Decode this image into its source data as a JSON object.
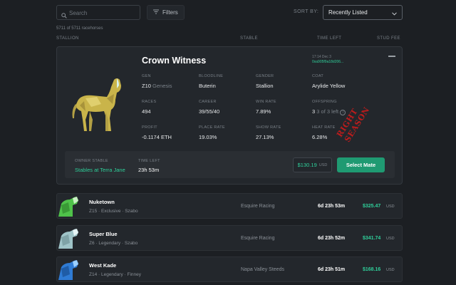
{
  "search": {
    "placeholder": "Search",
    "icon": "search-icon"
  },
  "filters": {
    "label": "Filters",
    "icon": "filter-icon"
  },
  "sort": {
    "label": "SORT BY:",
    "selected": "Recently Listed",
    "icon": "chevron-down-icon"
  },
  "count": "5711 of 5711 racehorses",
  "columns": {
    "stallion": "STALLION",
    "stable": "STABLE",
    "time_left": "TIME LEFT",
    "stud_fee": "STUD FEE"
  },
  "expanded": {
    "name": "Crown Witness",
    "tx_meta": "17:14 Dec 3",
    "tx_hash": "0xa905f9a18d206...",
    "stats": [
      {
        "label": "GEN",
        "value": "Z10",
        "sub": "Genesis"
      },
      {
        "label": "BLOODLINE",
        "value": "Buterin"
      },
      {
        "label": "GENDER",
        "value": "Stallion"
      },
      {
        "label": "COAT",
        "value": "Arylide Yellow"
      },
      {
        "label": "RACES",
        "value": "494"
      },
      {
        "label": "CAREER",
        "value": "39/55/40"
      },
      {
        "label": "WIN RATE",
        "value": "7.89%"
      },
      {
        "label": "OFFSPRING",
        "value": "3",
        "sub": "3 of 3 left"
      },
      {
        "label": "PROFIT",
        "value": "-0.1174 ETH"
      },
      {
        "label": "PLACE RATE",
        "value": "19.03%"
      },
      {
        "label": "SHOW RATE",
        "value": "27.13%"
      },
      {
        "label": "HEAT RATE",
        "value": "6.28%"
      }
    ],
    "stamp_text": "RIGHT SEASON",
    "owner_stable_label": "OWNER STABLE",
    "owner_stable": "Stables at Terra Jane",
    "time_left_label": "TIME LEFT",
    "time_left": "23h 53m",
    "price": "$130.19",
    "price_currency": "USD",
    "select_label": "Select Mate",
    "coat_color": "#c9b44a"
  },
  "rows": [
    {
      "name": "Nuketown",
      "sub": "Z15 · Exclusive · Szabo",
      "stable": "Esquire Racing",
      "time": "6d 23h 53m",
      "price": "$325.47",
      "currency": "USD",
      "coat_color": "#4fc24a"
    },
    {
      "name": "Super Blue",
      "sub": "Z6 · Legendary · Szabo",
      "stable": "Esquire Racing",
      "time": "6d 23h 52m",
      "price": "$341.74",
      "currency": "USD",
      "coat_color": "#9fc4c8"
    },
    {
      "name": "West Kade",
      "sub": "Z14 · Legendary · Finney",
      "stable": "Napa Valley Steeds",
      "time": "6d 23h 51m",
      "price": "$168.16",
      "currency": "USD",
      "coat_color": "#2f7bd4"
    }
  ]
}
